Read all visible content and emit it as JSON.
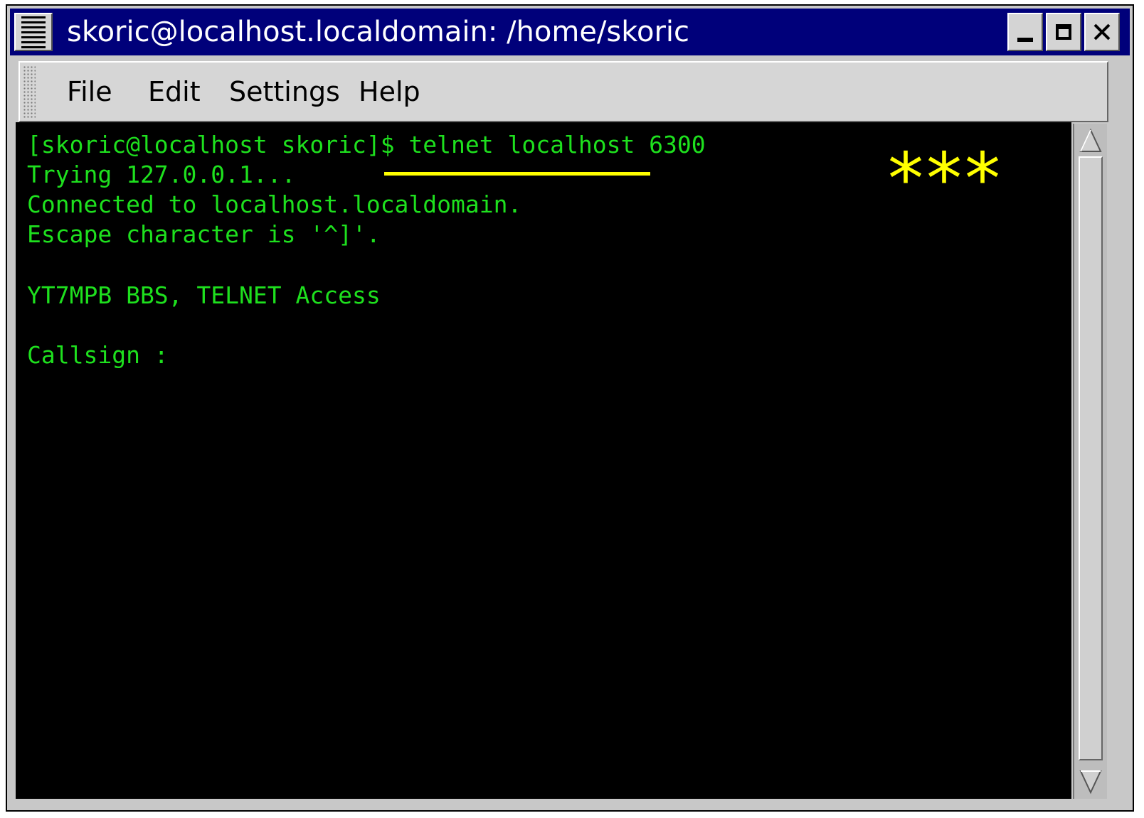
{
  "window": {
    "title": "skoric@localhost.localdomain: /home/skoric",
    "menu_icon": "window-menu-icon",
    "controls": {
      "minimize_icon": "minimize-icon",
      "maximize_icon": "maximize-icon",
      "close_icon": "close-icon",
      "close_glyph": "✕"
    }
  },
  "menubar": {
    "items": [
      "File",
      "Edit",
      "Settings",
      "Help"
    ]
  },
  "terminal": {
    "lines": [
      "[skoric@localhost skoric]$ telnet localhost 6300",
      "Trying 127.0.0.1...",
      "Connected to localhost.localdomain.",
      "Escape character is '^]'.",
      "YT7MPB BBS, TELNET Access",
      "Callsign :"
    ],
    "text_color": "#1ee01e",
    "background": "#000000"
  },
  "annotation": {
    "stars": "***",
    "color": "#ffff00"
  },
  "colors": {
    "titlebar": "#00007a",
    "chrome": "#d6d6d6"
  }
}
